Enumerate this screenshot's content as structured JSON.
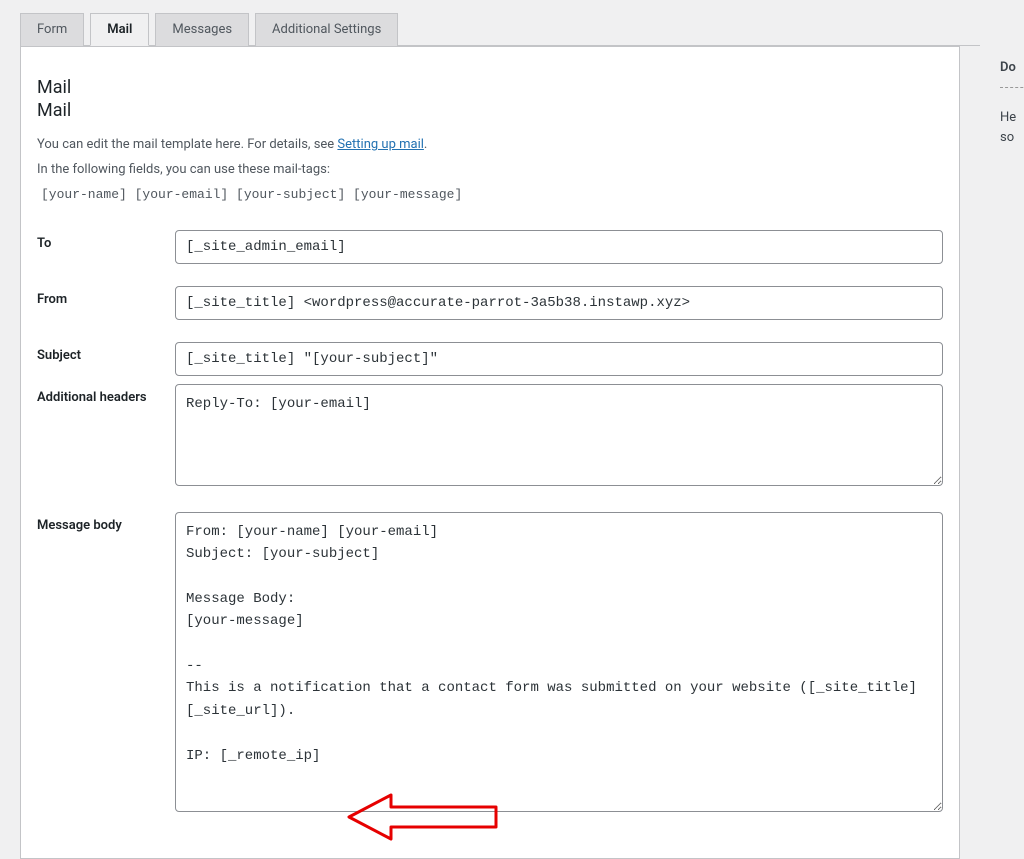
{
  "tabs": {
    "form": "Form",
    "mail": "Mail",
    "messages": "Messages",
    "additional": "Additional Settings"
  },
  "section": {
    "title1": "Mail",
    "title2": "Mail",
    "intro": "You can edit the mail template here. For details, see ",
    "intro_link": "Setting up mail",
    "intro_suffix": ".",
    "mailtags_intro": "In the following fields, you can use these mail-tags:",
    "mailtags": "[your-name] [your-email] [your-subject] [your-message]"
  },
  "labels": {
    "to": "To",
    "from": "From",
    "subject": "Subject",
    "additional_headers": "Additional headers",
    "message_body": "Message body"
  },
  "fields": {
    "to": "[_site_admin_email]",
    "from": "[_site_title] <wordpress@accurate-parrot-3a5b38.instawp.xyz>",
    "subject": "[_site_title] \"[your-subject]\"",
    "additional_headers": "Reply-To: [your-email]",
    "message_body": "From: [your-name] [your-email]\nSubject: [your-subject]\n\nMessage Body:\n[your-message]\n\n-- \nThis is a notification that a contact form was submitted on your website ([_site_title] [_site_url]).\n\nIP: [_remote_ip]"
  },
  "sidebar": {
    "heading": "Do",
    "text1": "He",
    "text2": "so"
  }
}
